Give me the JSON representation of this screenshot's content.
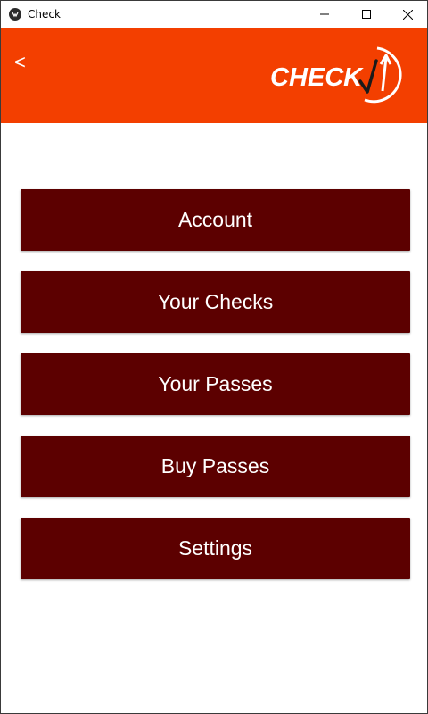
{
  "window": {
    "title": "Check"
  },
  "header": {
    "back_label": "<",
    "logo_text": "CHECK",
    "accent_color": "#f33f00"
  },
  "menu": {
    "items": [
      {
        "label": "Account"
      },
      {
        "label": "Your Checks"
      },
      {
        "label": "Your Passes"
      },
      {
        "label": "Buy Passes"
      },
      {
        "label": "Settings"
      }
    ],
    "button_color": "#5c0000"
  },
  "icons": {
    "app": "kivy-app-icon",
    "minimize": "minimize-icon",
    "maximize": "maximize-icon",
    "close": "close-icon"
  }
}
